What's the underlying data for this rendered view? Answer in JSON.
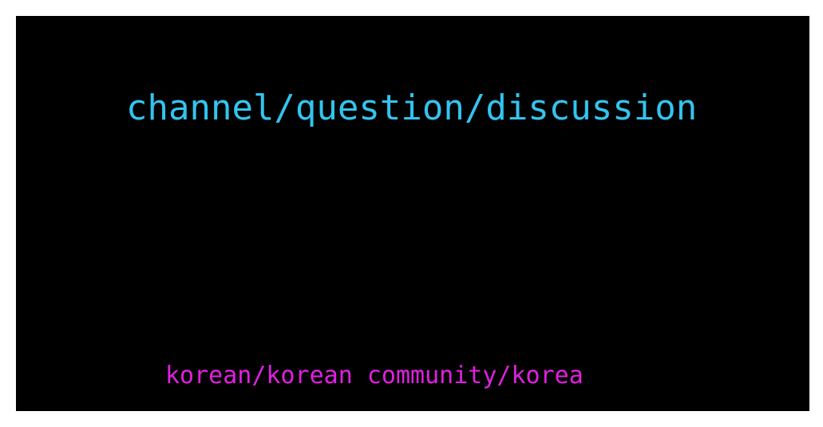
{
  "headline": {
    "text": "channel/question/discussion",
    "color": "#33c4ef"
  },
  "tags": {
    "text": "korean/korean community/korea",
    "color": "#e020e0"
  },
  "colors": {
    "panel_background": "#000000",
    "page_background": "#ffffff"
  }
}
